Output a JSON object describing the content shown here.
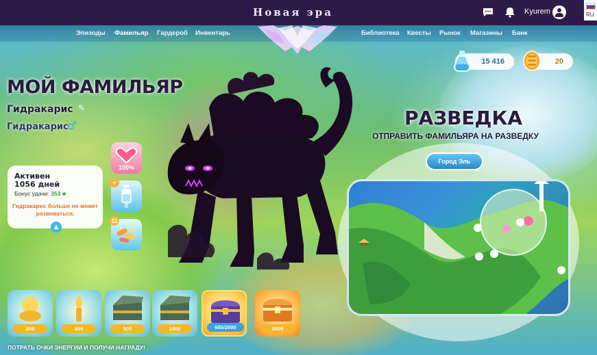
{
  "header": {
    "title": "Новая эра",
    "username": "Kyurem",
    "language": "RU",
    "icons": [
      "chat-icon",
      "bell-icon",
      "user-avatar-icon"
    ]
  },
  "nav": {
    "items": [
      {
        "label": "Эпизоды"
      },
      {
        "label": "Фамильяр",
        "active": true
      },
      {
        "label": "Гардероб"
      },
      {
        "label": "Инвентарь"
      },
      {
        "label": "Библиотека"
      },
      {
        "label": "Квесты"
      },
      {
        "label": "Рынок"
      },
      {
        "label": "Магазины"
      },
      {
        "label": "Банк"
      }
    ]
  },
  "currency": {
    "potions": "15 416",
    "coins": "20"
  },
  "familiar": {
    "page_title": "МОЙ ФАМИЛЬЯР",
    "name": "Гидракарис",
    "species": "Гидракарис",
    "gender_icon": "male-icon",
    "status": {
      "active_label": "Активен",
      "days": "1056 дней",
      "luck_label": "Бонус удачи:",
      "luck_value": "353",
      "warning": "Гидракарис больше не может развиваться."
    },
    "stats": {
      "health": "100%",
      "energy": "0",
      "energy_badge": "+",
      "health_badge": "+",
      "vitamins_badge": "11"
    }
  },
  "exploration": {
    "title": "РАЗВЕДКА",
    "subtitle": "ОТПРАВИТЬ ФАМИЛЬЯРА НА РАЗВЕДКУ",
    "location_button": "Город Эль"
  },
  "chests": [
    {
      "value": "200",
      "kind": "golden-figure"
    },
    {
      "value": "300",
      "kind": "golden-torch"
    },
    {
      "value": "500",
      "kind": "green-chest"
    },
    {
      "value": "1000",
      "kind": "green-chest"
    },
    {
      "value": "655/2000",
      "kind": "purple-chest",
      "highlight": true,
      "progress": 0.3275
    },
    {
      "value": "3000",
      "kind": "orange-chest"
    }
  ],
  "footer": {
    "hint": "ПОТРАТЬ ОЧКИ ЭНЕРГИИ И ПОЛУЧИ НАГРАДУ!"
  }
}
